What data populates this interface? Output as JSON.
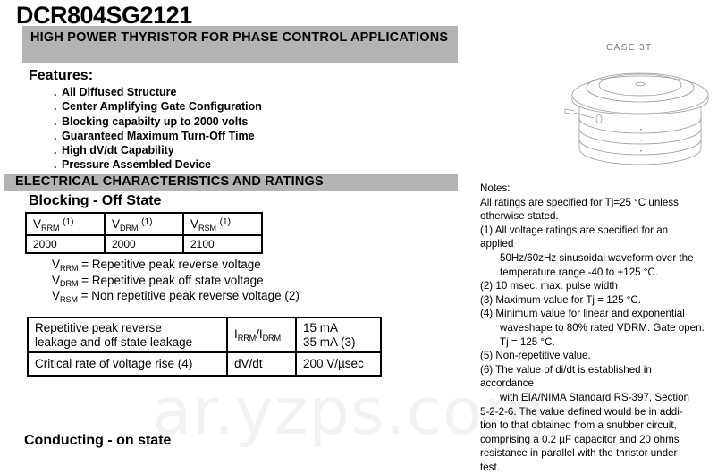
{
  "part_number": "DCR804SG2121",
  "title_banner": "HIGH POWER THYRISTOR FOR PHASE CONTROL APPLICATIONS",
  "features": {
    "heading": "Features:",
    "items": [
      "All Diffused Structure",
      "Center Amplifying Gate Configuration",
      "Blocking capabilty up to 2000 volts",
      "Guaranteed Maximum Turn-Off Time",
      "High dV/dt Capability",
      "Pressure Assembled Device"
    ]
  },
  "electrical_banner": "ELECTRICAL CHARACTERISTICS AND RATINGS",
  "blocking": {
    "heading": "Blocking - Off State",
    "table": {
      "headers": [
        {
          "sym": "V",
          "sub": "RRM",
          "note": "(1)"
        },
        {
          "sym": "V",
          "sub": "DRM",
          "note": "(1)"
        },
        {
          "sym": "V",
          "sub": "RSM",
          "note": "(1)"
        }
      ],
      "values": [
        "2000",
        "2000",
        "2100"
      ]
    },
    "legend": [
      {
        "sym": "V",
        "sub": "RRM",
        "text": "= Repetitive peak reverse voltage"
      },
      {
        "sym": "V",
        "sub": "DRM",
        "text": "= Repetitive peak off state voltage"
      },
      {
        "sym": "V",
        "sub": "RSM",
        "text": "= Non repetitive peak reverse voltage (2)"
      }
    ]
  },
  "params_table": {
    "rows": [
      {
        "desc_line1": "Repetitive peak reverse",
        "desc_line2": "leakage and off state leakage",
        "sym_a": "I",
        "sym_a_sub": "RRM",
        "sym_sep": "/",
        "sym_b": "I",
        "sym_b_sub": "DRM",
        "val_line1": "15 mA",
        "val_line2": "35 mA (3)"
      },
      {
        "desc_line1": "Critical rate of voltage rise (4)",
        "desc_line2": "",
        "sym_plain": "dV/dt",
        "val_line1": "200 V/µsec",
        "val_line2": ""
      }
    ]
  },
  "conducting_heading": "Conducting - on state",
  "case": {
    "label": "CASE 3T"
  },
  "notes": {
    "heading": "Notes:",
    "lines": [
      {
        "text": "All ratings are specified for Tj=25 °C unless",
        "indent": false
      },
      {
        "text": "otherwise stated.",
        "indent": false
      },
      {
        "text": "(1) All voltage ratings are specified for an",
        "indent": false
      },
      {
        "text": "applied",
        "indent": false
      },
      {
        "text": "50Hz/60zHz sinusoidal waveform over the",
        "indent": true
      },
      {
        "text": "temperature range  -40 to +125 °C.",
        "indent": true
      },
      {
        "text": "(2) 10 msec. max. pulse width",
        "indent": false
      },
      {
        "text": "(3) Maximum value for Tj = 125 °C.",
        "indent": false
      },
      {
        "text": "(4) Minimum value for linear and exponential",
        "indent": false
      },
      {
        "text": "waveshape to 80% rated VDRM. Gate open.",
        "indent": true
      },
      {
        "text": "Tj = 125 °C.",
        "indent": true
      },
      {
        "text": "(5) Non-repetitive value.",
        "indent": false
      },
      {
        "text": "(6) The value of di/dt is established in",
        "indent": false
      },
      {
        "text": "accordance",
        "indent": false
      },
      {
        "text": "with EIA/NIMA Standard RS-397, Section",
        "indent": true
      },
      {
        "text": "5-2-2-6. The value defined would be in addi-",
        "indent": false
      },
      {
        "text": "tion to that obtained from a snubber circuit,",
        "indent": false
      },
      {
        "text": "comprising a 0.2 µF capacitor and 20 ohms",
        "indent": false
      },
      {
        "text": "resistance in parallel with the thristor under",
        "indent": false
      },
      {
        "text": "test.",
        "indent": false
      }
    ]
  },
  "watermark": "ar.yzps.com",
  "colors": {
    "banner_gray": "#b3b3b3",
    "watermark": "#f2f2f2",
    "text": "#000000"
  }
}
